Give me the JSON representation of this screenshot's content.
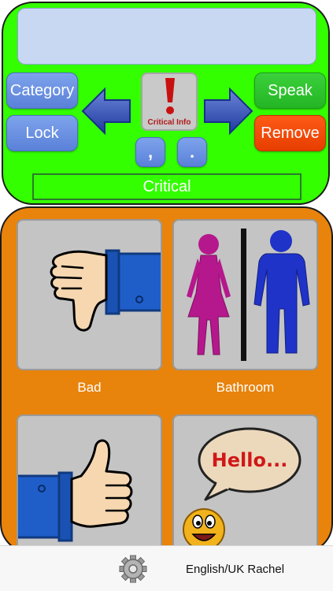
{
  "controls": {
    "category_label": "Category",
    "lock_label": "Lock",
    "speak_label": "Speak",
    "remove_label": "Remove",
    "critical_info_label": "Critical Info",
    "comma_label": ",",
    "period_label": "."
  },
  "current_category": "Critical",
  "tiles": [
    {
      "label": "Bad",
      "icon": "thumbs-down"
    },
    {
      "label": "Bathroom",
      "icon": "restroom"
    },
    {
      "label": "",
      "icon": "thumbs-up"
    },
    {
      "label": "",
      "icon": "hello-speech",
      "image_text": "Hello..."
    }
  ],
  "footer": {
    "settings_icon": "gear-icon",
    "voice_label": "English/UK Rachel"
  },
  "colors": {
    "top_panel": "#33ff00",
    "grid_panel": "#e8830c",
    "blue_button": "#6b91e2",
    "green_button": "#2ec22e",
    "red_button": "#f04a08"
  }
}
